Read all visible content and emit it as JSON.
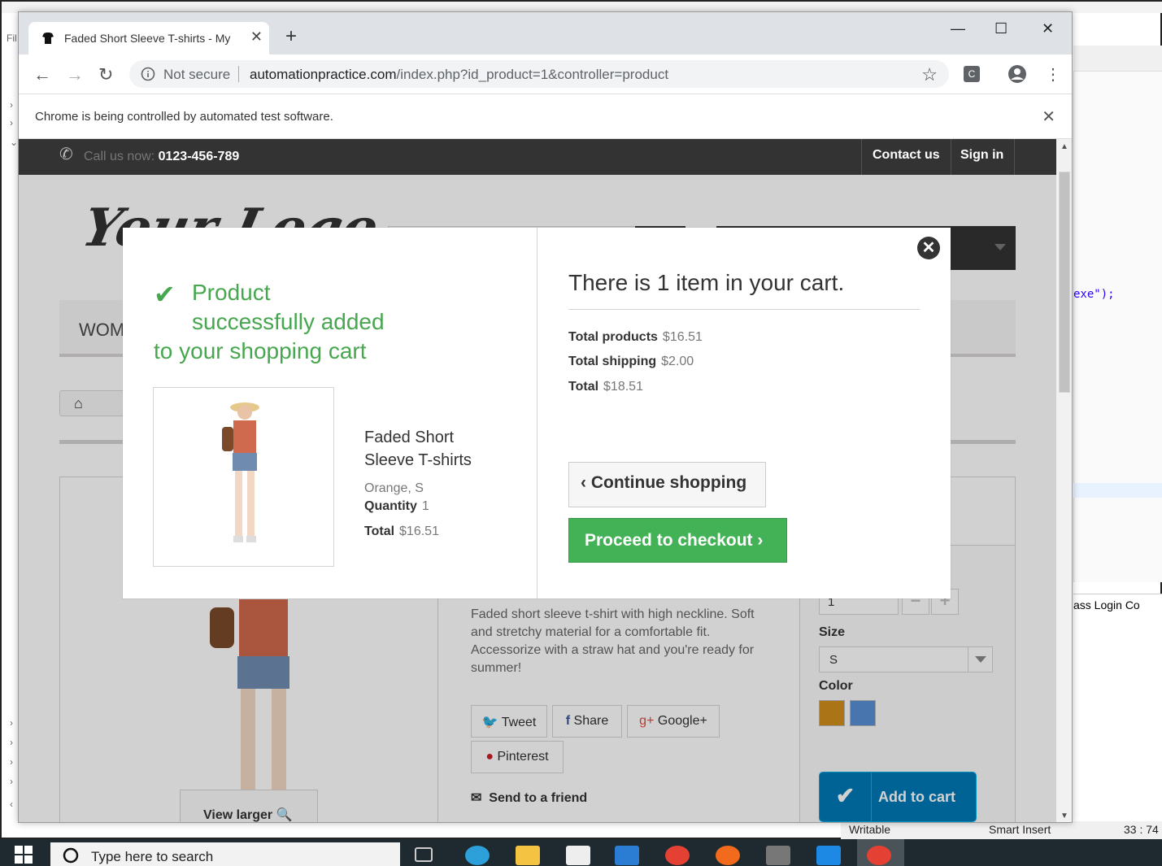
{
  "ide": {
    "code_line": "exe\");",
    "bottom_tabs": "ass Login  Co",
    "status": {
      "writable": "Writable",
      "insert": "Smart Insert",
      "position": "33 : 74"
    }
  },
  "taskbar": {
    "search_placeholder": "Type here to search"
  },
  "browser": {
    "tab_title": "Faded Short Sleeve T-shirts - My",
    "tab_close": "✕",
    "new_tab": "+",
    "minimize": "—",
    "maximize": "☐",
    "close": "✕",
    "not_secure": "Not secure",
    "url_host": "automationpractice.com",
    "url_path": "/index.php?id_product=1&controller=product",
    "infobar_text": "Chrome is being controlled by automated test software.",
    "infobar_close": "✕"
  },
  "site": {
    "call_label": "Call us now: ",
    "phone": "0123-456-789",
    "contact": "Contact us",
    "signin": "Sign in",
    "logo": "Your Logo",
    "menu_first": "WOM",
    "description": "Faded short sleeve t-shirt with high neckline. Soft and stretchy material for a comfortable fit. Accessorize with a straw hat and you're ready for summer!",
    "tweet": "Tweet",
    "share": "Share",
    "google": "Google+",
    "pinterest": "Pinterest",
    "send_friend": "Send to a friend",
    "view_larger": "View larger",
    "quantity_value": "1",
    "size_label": "Size",
    "size_value": "S",
    "color_label": "Color",
    "colors": [
      "#d18e1b",
      "#5a8fd6"
    ],
    "add_to_cart": "Add to cart"
  },
  "modal": {
    "success_line1": "Product",
    "success_line2": "successfully added",
    "success_line3": "to your shopping cart",
    "product_name": "Faded Short Sleeve T-shirts",
    "product_attrs": "Orange, S",
    "quantity_label": "Quantity",
    "quantity_value": "1",
    "total_label": "Total",
    "total_value": "$16.51",
    "cart_title": "There is 1 item in your cart.",
    "total_products_label": "Total products",
    "total_products_value": "$16.51",
    "total_shipping_label": "Total shipping",
    "total_shipping_value": "$2.00",
    "grand_total_label": "Total",
    "grand_total_value": "$18.51",
    "continue_label": "Continue shopping",
    "checkout_label": "Proceed to checkout",
    "close_icon": "close-icon",
    "accent_color": "#46a74e"
  }
}
